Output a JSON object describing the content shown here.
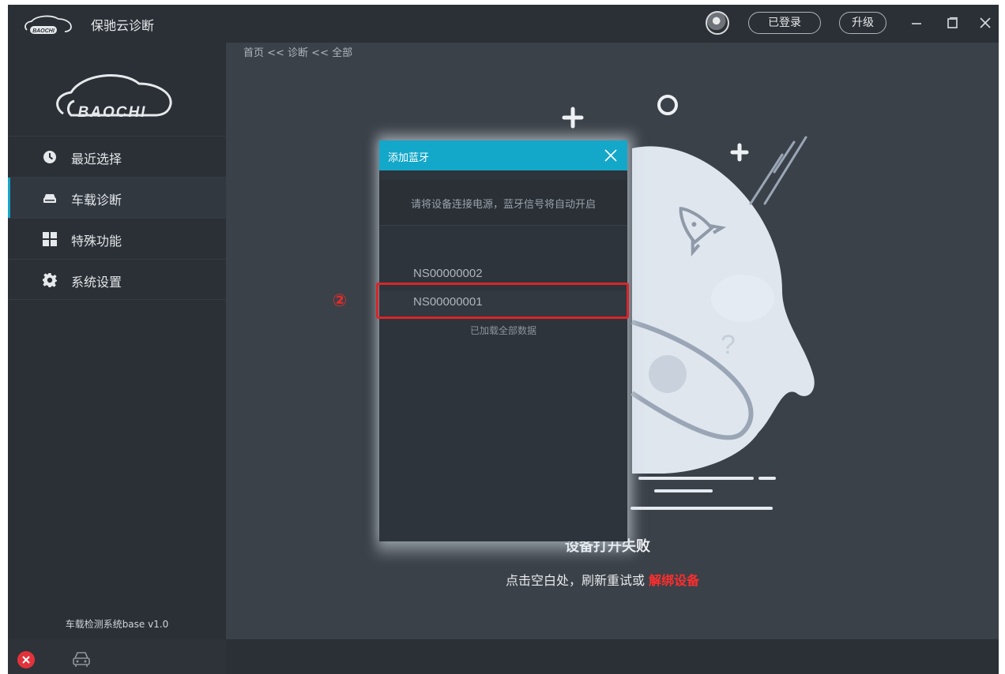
{
  "titlebar": {
    "brand_logo_text": "BAOCHI",
    "app_title": "保驰云诊断",
    "login_label": "已登录",
    "upgrade_label": "升级"
  },
  "sidebar": {
    "logo_text": "BAOCHI",
    "items": [
      {
        "label": "最近选择",
        "icon": "clock-icon"
      },
      {
        "label": "车载诊断",
        "icon": "car-icon",
        "active": true
      },
      {
        "label": "特殊功能",
        "icon": "grid-icon"
      },
      {
        "label": "系统设置",
        "icon": "gear-icon"
      }
    ],
    "version": "车载检测系统base v1.0"
  },
  "main": {
    "breadcrumb": "首页 << 诊断 << 全部",
    "fail_title": "设备打开失败",
    "fail_desc_prefix": "点击空白处，刷新重试或 ",
    "fail_desc_link": "解绑设备",
    "illustration_mark": "?"
  },
  "modal": {
    "title": "添加蓝牙",
    "hint": "请将设备连接电源，蓝牙信号将自动开启",
    "devices": [
      {
        "name": "NS00000002"
      },
      {
        "name": "NS00000001"
      }
    ],
    "loaded_text": "已加载全部数据"
  },
  "annotation": {
    "step_number": "②"
  },
  "colors": {
    "accent": "#13a7c9",
    "error": "#e2333b",
    "link_red": "#ff2d2d",
    "annotation_red": "#d8262a"
  }
}
